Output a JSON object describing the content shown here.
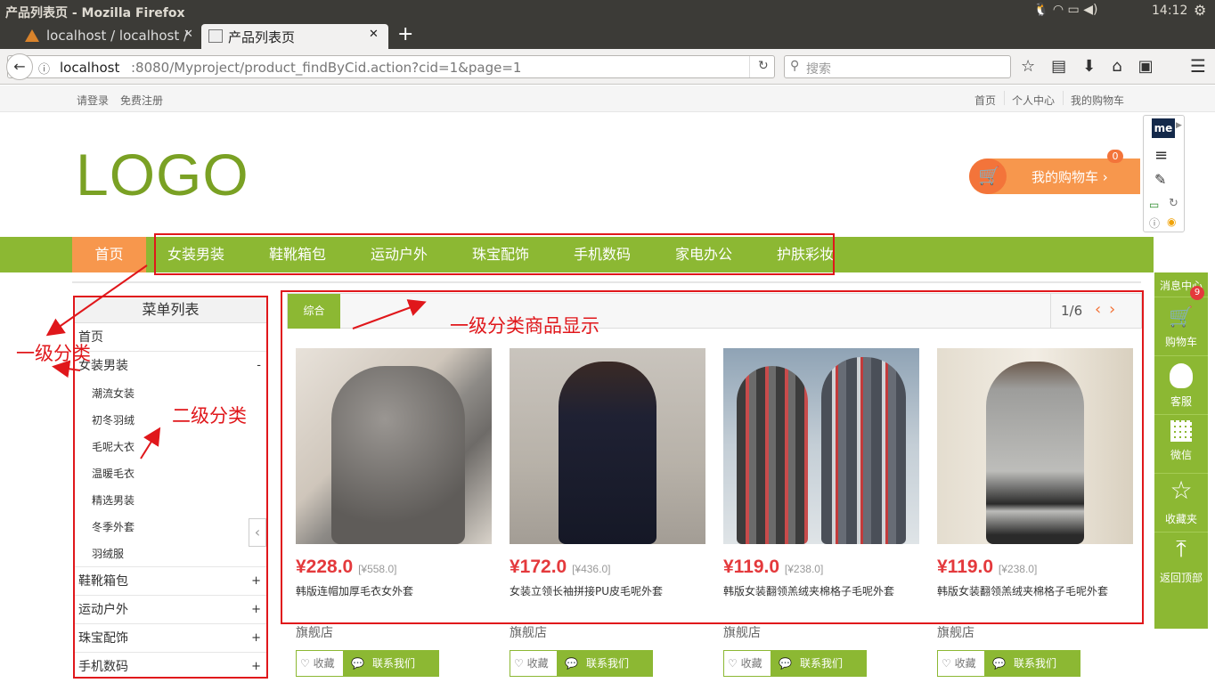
{
  "os": {
    "title": "产品列表页 - Mozilla Firefox",
    "time": "14:12"
  },
  "tabs": [
    {
      "label": "localhost / localhost / "
    },
    {
      "label": "产品列表页"
    }
  ],
  "url": {
    "prefix": "localhost",
    "rest": ":8080/Myproject/product_findByCid.action?cid=1&page=1"
  },
  "search_placeholder": "搜索",
  "topbar": {
    "login": "请登录",
    "register": "免费注册",
    "home": "首页",
    "center": "个人中心",
    "mycart": "我的购物车"
  },
  "logo": "LOGO",
  "cart": {
    "label": "我的购物车 ›",
    "count": "0"
  },
  "nav": [
    "首页",
    "女装男装",
    "鞋靴箱包",
    "运动户外",
    "珠宝配饰",
    "手机数码",
    "家电办公",
    "护肤彩妆"
  ],
  "menu": {
    "title": "菜单列表",
    "items": [
      {
        "label": "首页",
        "sign": ""
      },
      {
        "label": "女装男装",
        "sign": "-"
      },
      {
        "label": "鞋靴箱包",
        "sign": "+"
      },
      {
        "label": "运动户外",
        "sign": "+"
      },
      {
        "label": "珠宝配饰",
        "sign": "+"
      },
      {
        "label": "手机数码",
        "sign": "+"
      }
    ],
    "subs": [
      "潮流女装",
      "初冬羽绒",
      "毛呢大衣",
      "温暖毛衣",
      "精选男装",
      "冬季外套",
      "羽绒服"
    ]
  },
  "panel": {
    "tab": "综合",
    "page": "1/6"
  },
  "products": [
    {
      "price": "¥228.0",
      "old": "[¥558.0]",
      "name": "韩版连帽加厚毛衣女外套",
      "shop": "旗舰店"
    },
    {
      "price": "¥172.0",
      "old": "[¥436.0]",
      "name": "女装立领长袖拼接PU皮毛呢外套",
      "shop": "旗舰店"
    },
    {
      "price": "¥119.0",
      "old": "[¥238.0]",
      "name": "韩版女装翻领羔绒夹棉格子毛呢外套",
      "shop": "旗舰店"
    },
    {
      "price": "¥119.0",
      "old": "[¥238.0]",
      "name": "韩版女装翻领羔绒夹棉格子毛呢外套",
      "shop": "旗舰店"
    }
  ],
  "buttons": {
    "fav": "收藏",
    "contact": "联系我们"
  },
  "rightbar": {
    "msg": "消息中心",
    "cart": "购物车",
    "cart_count": "9",
    "service": "客服",
    "wechat": "微信",
    "fav": "收藏夹",
    "top": "返回顶部"
  },
  "annotations": {
    "a1": "一级分类",
    "a2": "二级分类",
    "a3": "一级分类商品显示"
  },
  "colors": {
    "green": "#8cb833",
    "orange": "#f7974d",
    "red": "#e4393c",
    "annotation": "#e0171b"
  }
}
